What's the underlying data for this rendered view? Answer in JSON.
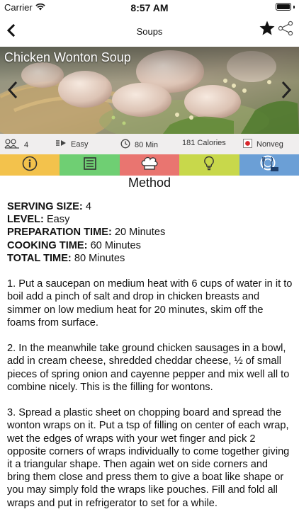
{
  "status_bar": {
    "carrier": "Carrier",
    "time": "8:57 AM",
    "battery_level": 1.0
  },
  "nav": {
    "back_label": "<",
    "title": "Soups",
    "star_icon": "star-icon",
    "share_icon": "share-icon"
  },
  "hero": {
    "title": "Chicken Wonton Soup",
    "prev_icon": "chevron-left-icon",
    "next_icon": "chevron-right-icon"
  },
  "info_bar": {
    "servings": "4",
    "level": "Easy",
    "time": "80 Min",
    "calories": "181 Calories",
    "diet": "Nonveg",
    "diet_color": "#d8262c"
  },
  "tabs": [
    {
      "name": "info",
      "icon": "info-icon",
      "color": "#f3c24c"
    },
    {
      "name": "ingredients",
      "icon": "list-icon",
      "color": "#6fcf73"
    },
    {
      "name": "method",
      "icon": "chef-hat-icon",
      "color": "#e97570"
    },
    {
      "name": "tips",
      "icon": "lightbulb-icon",
      "color": "#c8d84b"
    },
    {
      "name": "nutrition",
      "icon": "plate-icon",
      "color": "#6b9fd6"
    }
  ],
  "section_title": "Method",
  "meta": {
    "serving_label": "SERVING SIZE:",
    "serving_value": " 4",
    "level_label": "LEVEL:",
    "level_value": " Easy",
    "prep_label": "PREPARATION TIME:",
    "prep_value": " 20 Minutes",
    "cook_label": "COOKING TIME:",
    "cook_value": " 60 Minutes",
    "total_label": "TOTAL TIME:",
    "total_value": " 80 Minutes"
  },
  "steps": [
    "1. Put a saucepan on medium heat with 6 cups of water in it to boil add a pinch of salt and drop in chicken breasts and simmer on low medium heat for 20 minutes, skim off the foams from surface.",
    "2. In the meanwhile take ground chicken sausages in a bowl, add in cream cheese, shredded cheddar cheese, ½ of small pieces of spring onion and cayenne pepper and mix well all to combine nicely. This is the filling for wontons.",
    "3. Spread a plastic sheet on chopping board and spread the wonton wraps on it. Put a tsp of filling on center of each wrap, wet the edges of wraps with your wet finger and pick 2 opposite corners of wraps individually to come together giving it a triangular shape. Then again wet on side corners and bring them close and press them to give a boat like shape or you may simply fold the wraps like pouches. Fill and fold all wraps and put in refrigerator to set for a while."
  ]
}
